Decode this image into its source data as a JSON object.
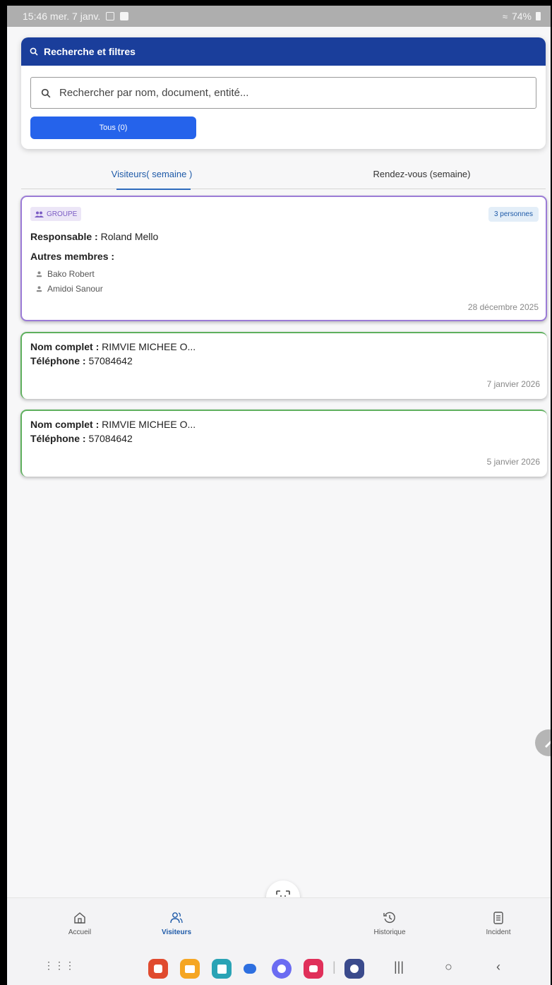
{
  "status_bar": {
    "time_date": "15:46  mer. 7 janv.",
    "battery": "74%"
  },
  "search_panel": {
    "title": "Recherche et filtres",
    "search_placeholder": "Rechercher par nom, document, entité...",
    "filter_button": "Tous (0)"
  },
  "tabs": [
    {
      "label": "Visiteurs( semaine )",
      "active": true
    },
    {
      "label": "Rendez-vous (semaine)",
      "active": false
    }
  ],
  "group_card": {
    "badge": "GROUPE",
    "count": "3 personnes",
    "responsable_label": "Responsable :",
    "responsable_value": "Roland Mello",
    "others_label": "Autres membres :",
    "members": [
      "Bako Robert",
      "Amidoi Sanour"
    ],
    "date": "28 décembre 2025"
  },
  "visitors": [
    {
      "name_label": "Nom complet :",
      "name": "RIMVIE MICHEE O...",
      "phone_label": "Téléphone :",
      "phone": "57084642",
      "date": "7 janvier 2026"
    },
    {
      "name_label": "Nom complet :",
      "name": "RIMVIE MICHEE O...",
      "phone_label": "Téléphone :",
      "phone": "57084642",
      "date": "5 janvier 2026"
    }
  ],
  "bottom_nav": [
    {
      "label": "Accueil",
      "icon": "home-icon"
    },
    {
      "label": "Visiteurs",
      "icon": "users-icon",
      "active": true
    },
    {
      "label": "Historique",
      "icon": "history-icon"
    },
    {
      "label": "Incident",
      "icon": "incident-icon"
    }
  ],
  "colors": {
    "header_blue": "#1a3e9b",
    "button_blue": "#2563eb",
    "group_border": "#9b7bd6",
    "visitor_border": "#5fb05e"
  }
}
